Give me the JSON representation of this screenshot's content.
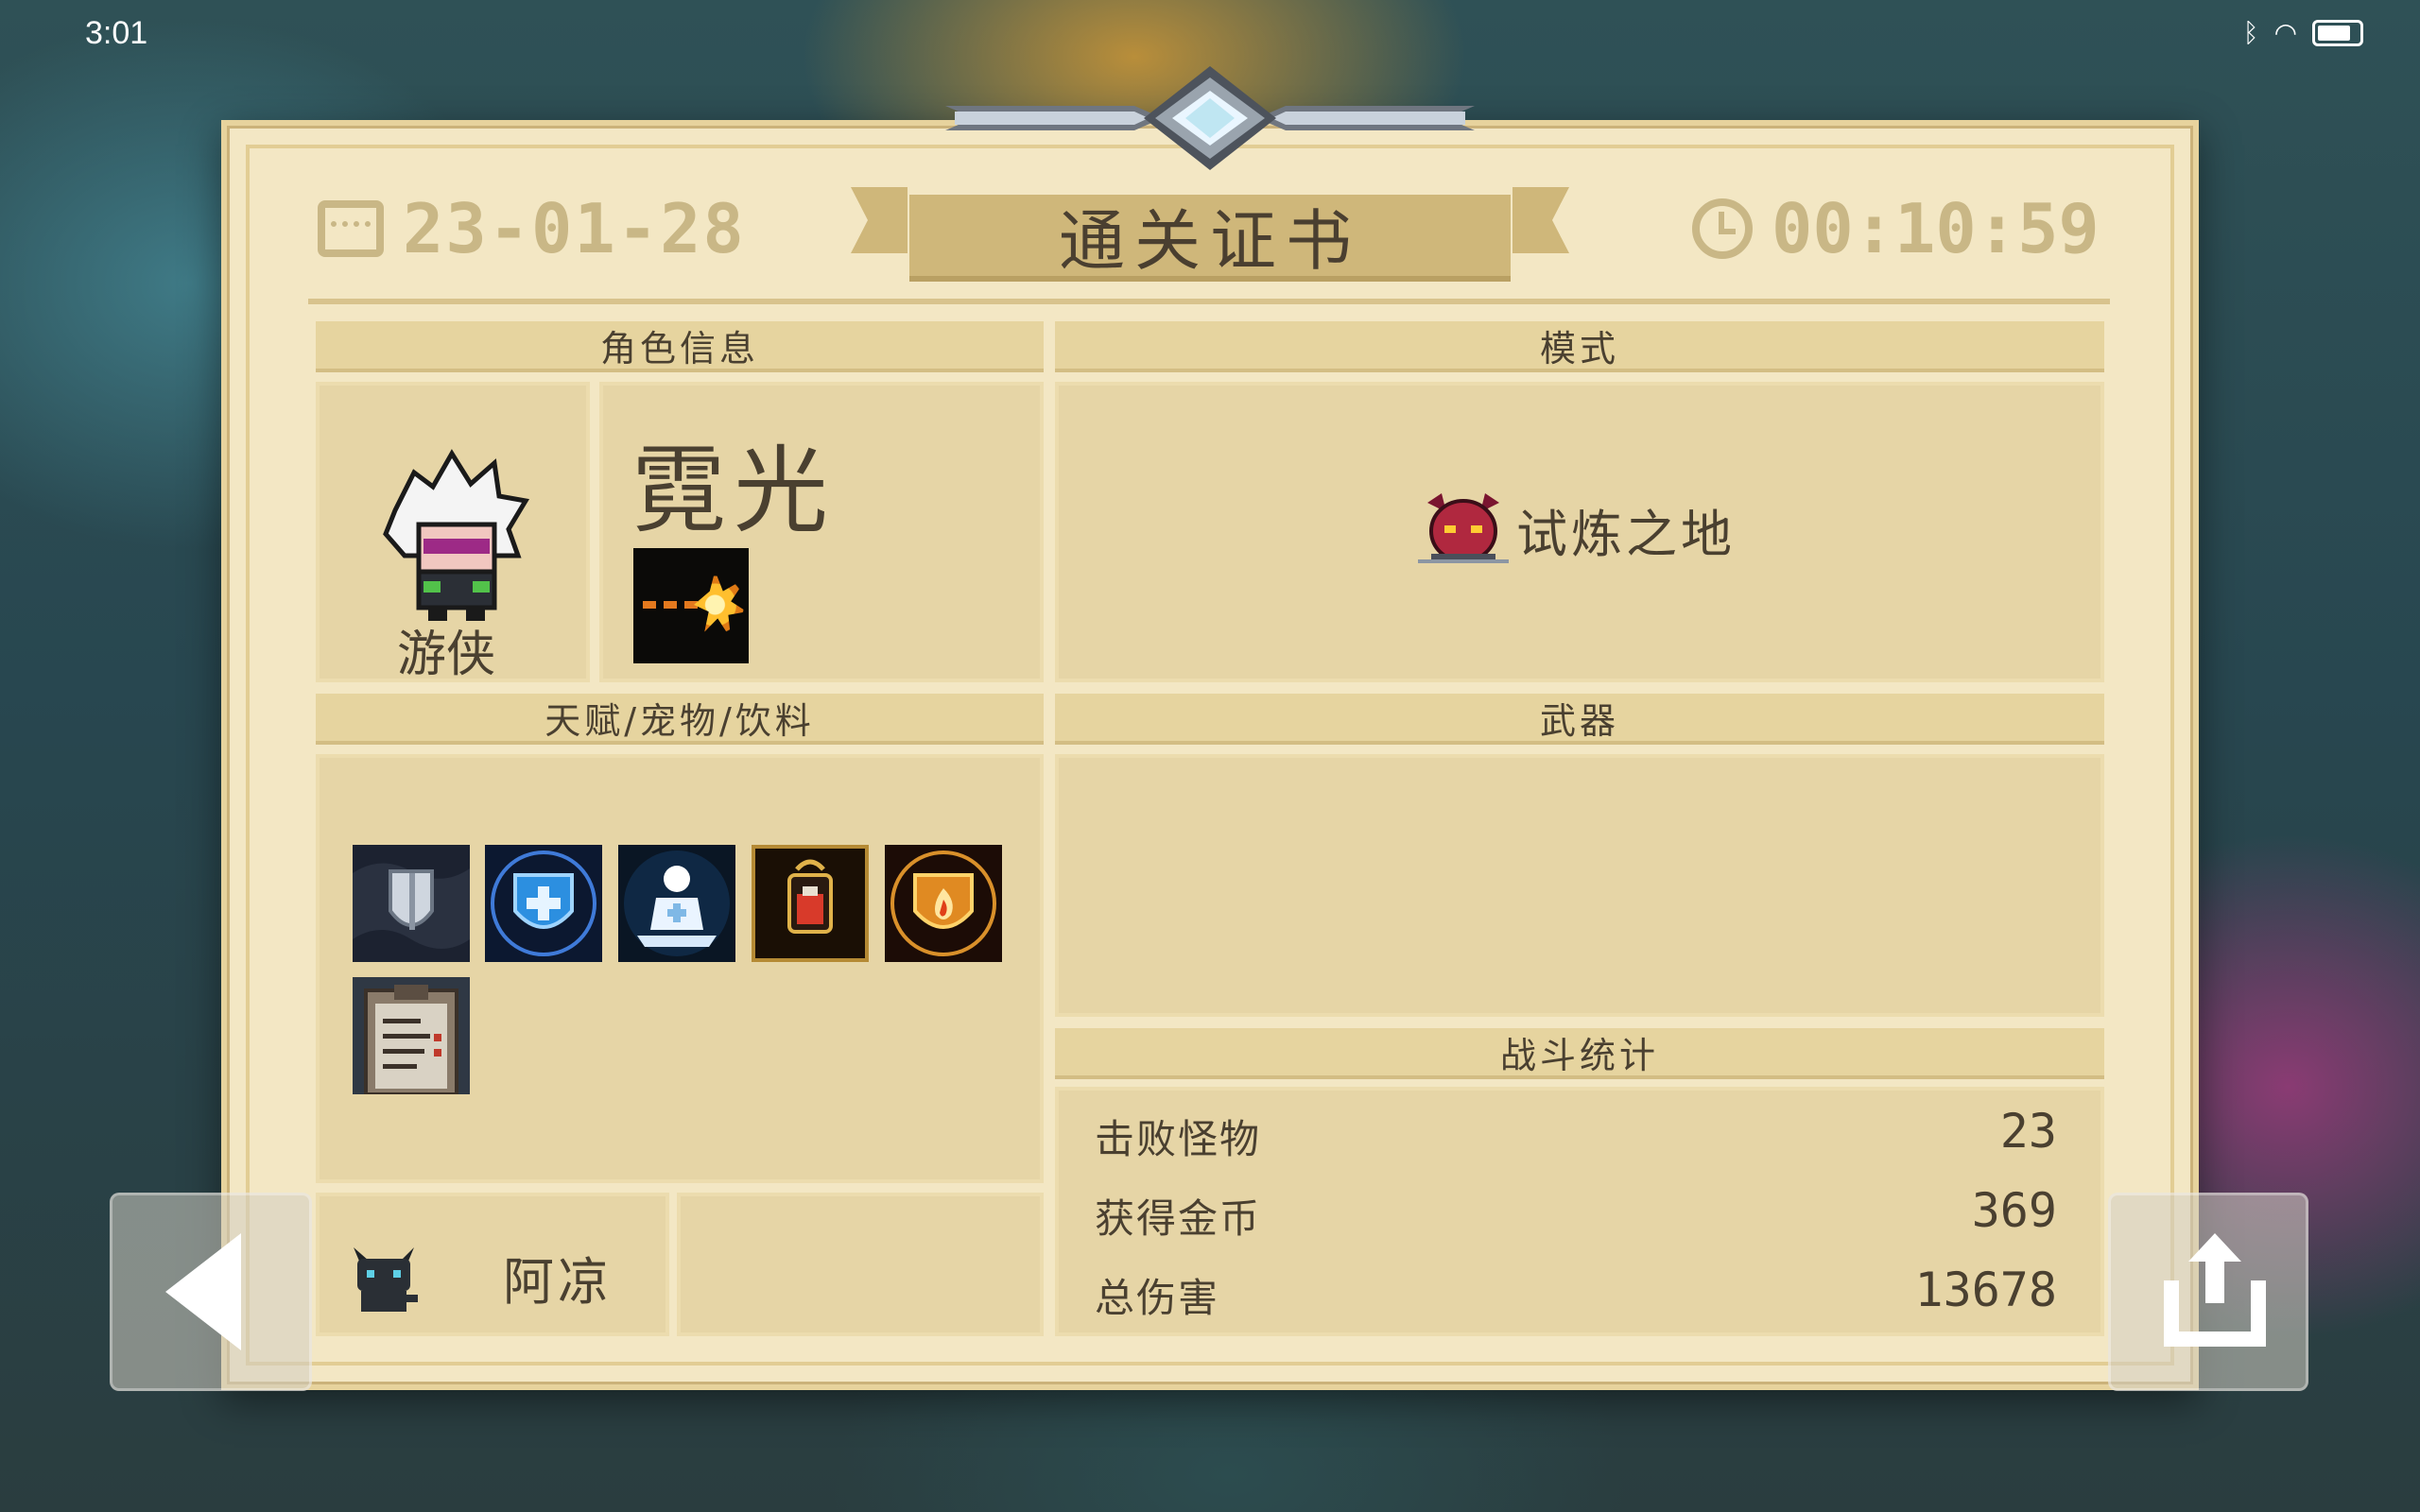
{
  "status_bar": {
    "time": "3:01"
  },
  "certificate": {
    "title": "通关证书",
    "date": "23-01-28",
    "elapsed": "00:10:59"
  },
  "sections": {
    "character_info": "角色信息",
    "mode": "模式",
    "talent_pet_drink": "天赋/宠物/饮料",
    "weapons": "武器",
    "battle_stats": "战斗统计"
  },
  "character": {
    "skin_name": "霓光",
    "class_name": "游侠"
  },
  "mode": {
    "name": "试炼之地"
  },
  "pet": {
    "name": "阿凉"
  },
  "talents": [
    {
      "icon": "armor-shield-icon"
    },
    {
      "icon": "blue-cross-shield-icon"
    },
    {
      "icon": "meditating-figure-icon"
    },
    {
      "icon": "potion-icon"
    },
    {
      "icon": "fire-shield-icon"
    },
    {
      "icon": "clipboard-icon"
    }
  ],
  "battle_stats": [
    {
      "label": "击败怪物",
      "value": "23"
    },
    {
      "label": "获得金币",
      "value": "369"
    },
    {
      "label": "总伤害",
      "value": "13678"
    }
  ]
}
